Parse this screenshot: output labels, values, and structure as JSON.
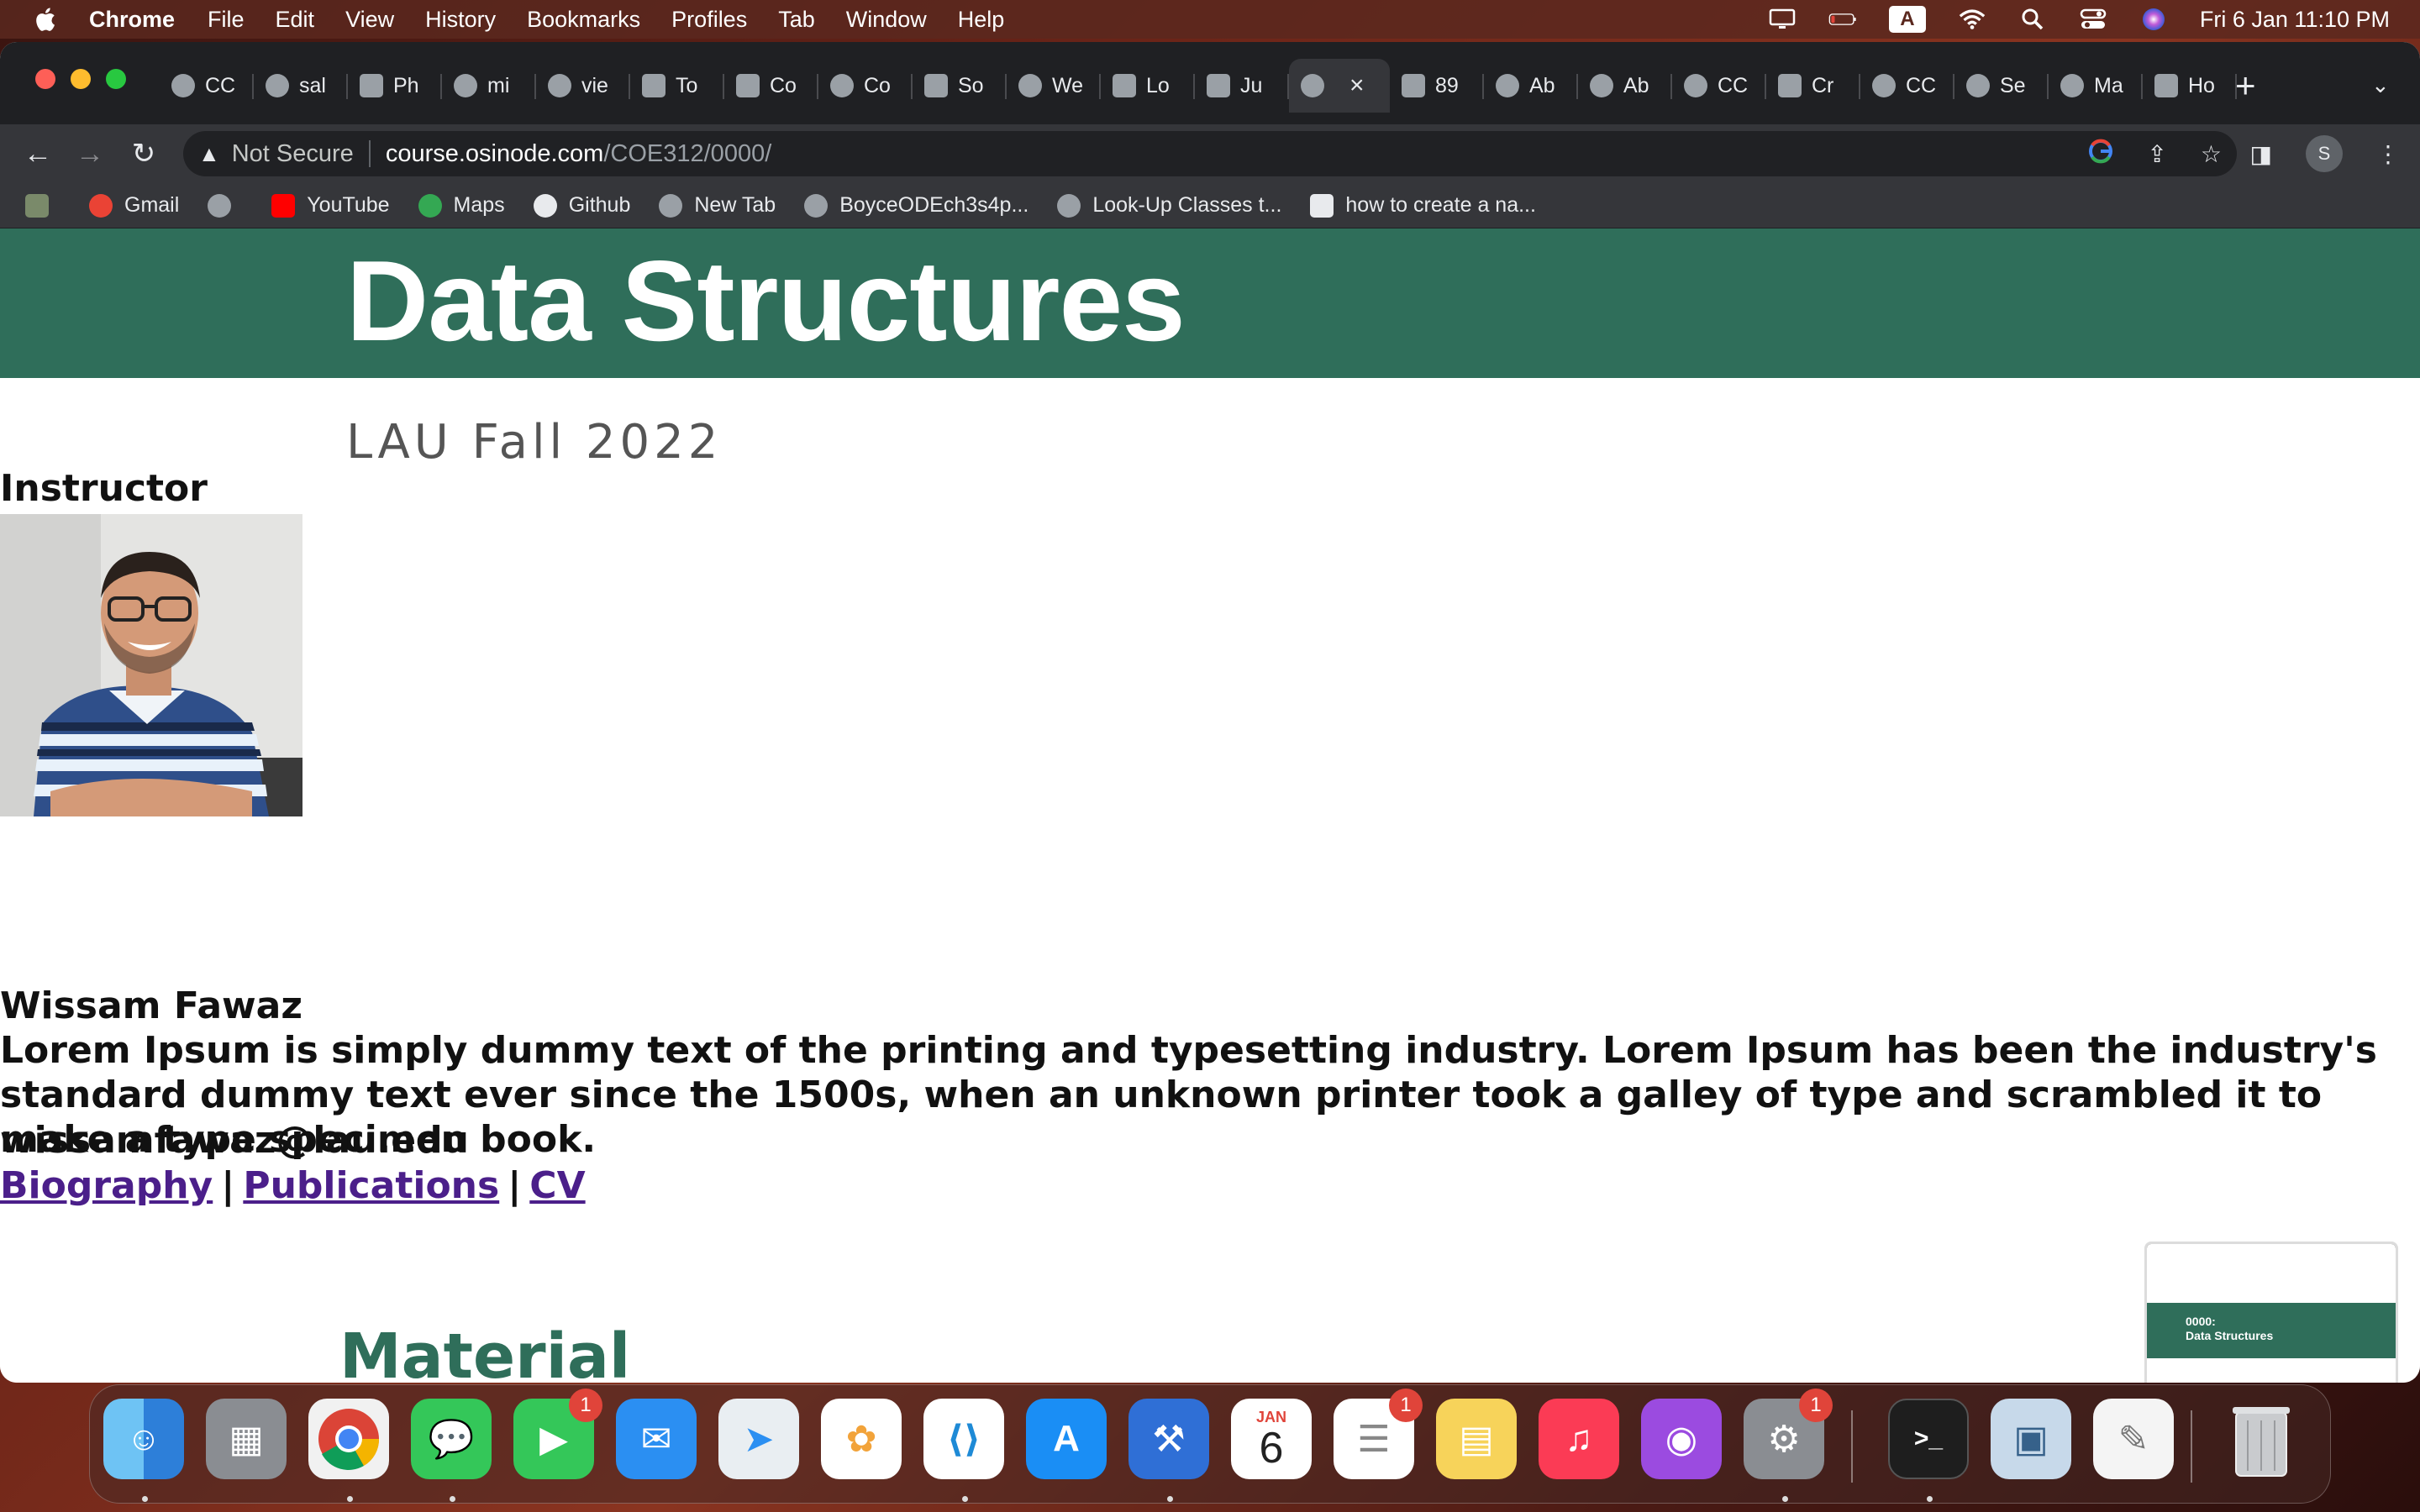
{
  "menubar": {
    "app_name": "Chrome",
    "items": [
      "File",
      "Edit",
      "View",
      "History",
      "Bookmarks",
      "Profiles",
      "Tab",
      "Window",
      "Help"
    ],
    "input_source": "A",
    "clock": "Fri 6 Jan  11:10 PM"
  },
  "tabs": [
    {
      "label": "CC",
      "icon": "globe-icon"
    },
    {
      "label": "sal",
      "icon": "github-icon"
    },
    {
      "label": "Ph",
      "icon": "site-icon"
    },
    {
      "label": "mi",
      "icon": "google-icon"
    },
    {
      "label": "vie",
      "icon": "globe-icon"
    },
    {
      "label": "To",
      "icon": "colorlib-icon"
    },
    {
      "label": "Co",
      "icon": "colorlib-icon"
    },
    {
      "label": "Co",
      "icon": "globe-icon"
    },
    {
      "label": "So",
      "icon": "site-icon"
    },
    {
      "label": "We",
      "icon": "globe-icon"
    },
    {
      "label": "Lo",
      "icon": "w3schools-icon"
    },
    {
      "label": "Ju",
      "icon": "site-icon"
    },
    {
      "label": "",
      "icon": "globe-icon",
      "active": true
    },
    {
      "label": "89",
      "icon": "f-icon"
    },
    {
      "label": "Ab",
      "icon": "codepen-icon"
    },
    {
      "label": "Ab",
      "icon": "codepen-icon"
    },
    {
      "label": "CC",
      "icon": "globe-icon"
    },
    {
      "label": "Cr",
      "icon": "site-icon"
    },
    {
      "label": "CC",
      "icon": "globe-icon"
    },
    {
      "label": "Se",
      "icon": "gear-icon"
    },
    {
      "label": "Ma",
      "icon": "globe-icon"
    },
    {
      "label": "Ho",
      "icon": "w-icon"
    }
  ],
  "omnibox": {
    "security": "Not Secure",
    "host": "course.osinode.com",
    "path": "/COE312/0000/"
  },
  "profile_initial": "S",
  "bookmarks": [
    {
      "label": "",
      "icon": "folder-icon"
    },
    {
      "label": "Gmail",
      "icon": "gmail-icon"
    },
    {
      "label": "",
      "icon": "globe-icon"
    },
    {
      "label": "YouTube",
      "icon": "youtube-icon"
    },
    {
      "label": "Maps",
      "icon": "maps-icon"
    },
    {
      "label": "Github",
      "icon": "github-icon"
    },
    {
      "label": "New Tab",
      "icon": "globe-icon"
    },
    {
      "label": "BoyceODEch3s4p...",
      "icon": "globe-icon"
    },
    {
      "label": "Look-Up Classes t...",
      "icon": "globe-icon"
    },
    {
      "label": "how to create a na...",
      "icon": "codepen-icon"
    }
  ],
  "page": {
    "title": "Data Structures",
    "subtitle": "LAU Fall 2022",
    "instructor_heading": "Instructor",
    "instructor_name": "Wissam Fawaz",
    "bio": "Lorem Ipsum is simply dummy text of the printing and typesetting industry. Lorem Ipsum has been the industry's standard dummy text ever since the 1500s, when an unknown printer took a galley of type and scrambled it to make a type specimen book.",
    "email": "wissamfawaz@lau.edu",
    "links": [
      "Biography",
      "Publications",
      "CV"
    ],
    "link_separator": "|",
    "section_heading": "Material",
    "accent_color": "#2f6e5a",
    "link_color": "#4b1f8a"
  },
  "pip_preview": {
    "line1": "0000:",
    "line2": "Data Structures"
  },
  "dock": {
    "calendar_month": "JAN",
    "calendar_day": "6",
    "badges": {
      "facetime": "1",
      "reminders": "1",
      "settings": "1"
    },
    "apps": [
      "Finder",
      "Launchpad",
      "Chrome",
      "Messages",
      "FaceTime",
      "Mail",
      "Maps",
      "Photos",
      "VS Code",
      "App Store",
      "Xcode",
      "Calendar",
      "Reminders",
      "Notes",
      "Music",
      "Podcasts",
      "System Settings",
      "Terminal",
      "Preview",
      "TextEdit",
      "Trash"
    ]
  }
}
